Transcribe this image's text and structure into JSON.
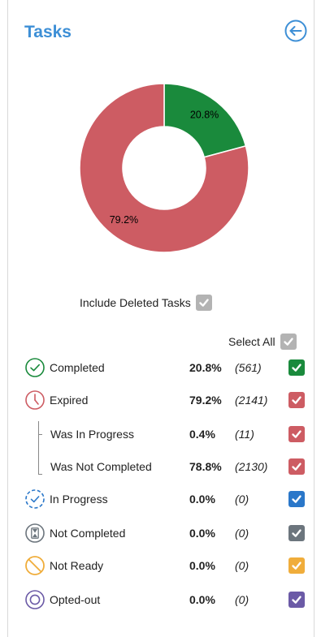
{
  "title": "Tasks",
  "colors": {
    "accent": "#3d8fd6",
    "completed": "#1a8a3c",
    "expired": "#cd5c63",
    "in_progress": "#2a77c9",
    "not_completed": "#6c757d",
    "not_ready": "#f0ad3b",
    "opted_out": "#6b5aa6",
    "neutral": "#b3b3b3"
  },
  "chart_data": {
    "type": "pie",
    "donut": true,
    "slices": [
      {
        "name": "Completed",
        "value": 20.8,
        "label": "20.8%",
        "color": "#1a8a3c"
      },
      {
        "name": "Expired",
        "value": 79.2,
        "label": "79.2%",
        "color": "#cd5c63"
      }
    ]
  },
  "include_deleted": {
    "label": "Include Deleted Tasks",
    "checked": true
  },
  "select_all": {
    "label": "Select All",
    "checked": true
  },
  "rows": [
    {
      "label": "Completed",
      "percent": "20.8%",
      "count": "(561)",
      "icon": "check-circle-icon",
      "color": "#1a8a3c",
      "checked": true
    },
    {
      "label": "Expired",
      "percent": "79.2%",
      "count": "(2141)",
      "icon": "clock-icon",
      "color": "#cd5c63",
      "checked": true
    },
    {
      "label": "Was In Progress",
      "percent": "0.4%",
      "count": "(11)",
      "icon": "",
      "color": "#cd5c63",
      "checked": true
    },
    {
      "label": "Was Not Completed",
      "percent": "78.8%",
      "count": "(2130)",
      "icon": "",
      "color": "#cd5c63",
      "checked": true
    },
    {
      "label": "In Progress",
      "percent": "0.0%",
      "count": "(0)",
      "icon": "progress-check-icon",
      "color": "#2a77c9",
      "checked": true
    },
    {
      "label": "Not Completed",
      "percent": "0.0%",
      "count": "(0)",
      "icon": "hourglass-icon",
      "color": "#6c757d",
      "checked": true
    },
    {
      "label": "Not Ready",
      "percent": "0.0%",
      "count": "(0)",
      "icon": "prohibited-icon",
      "color": "#f0ad3b",
      "checked": true
    },
    {
      "label": "Opted-out",
      "percent": "0.0%",
      "count": "(0)",
      "icon": "opted-out-icon",
      "color": "#6b5aa6",
      "checked": true
    }
  ]
}
